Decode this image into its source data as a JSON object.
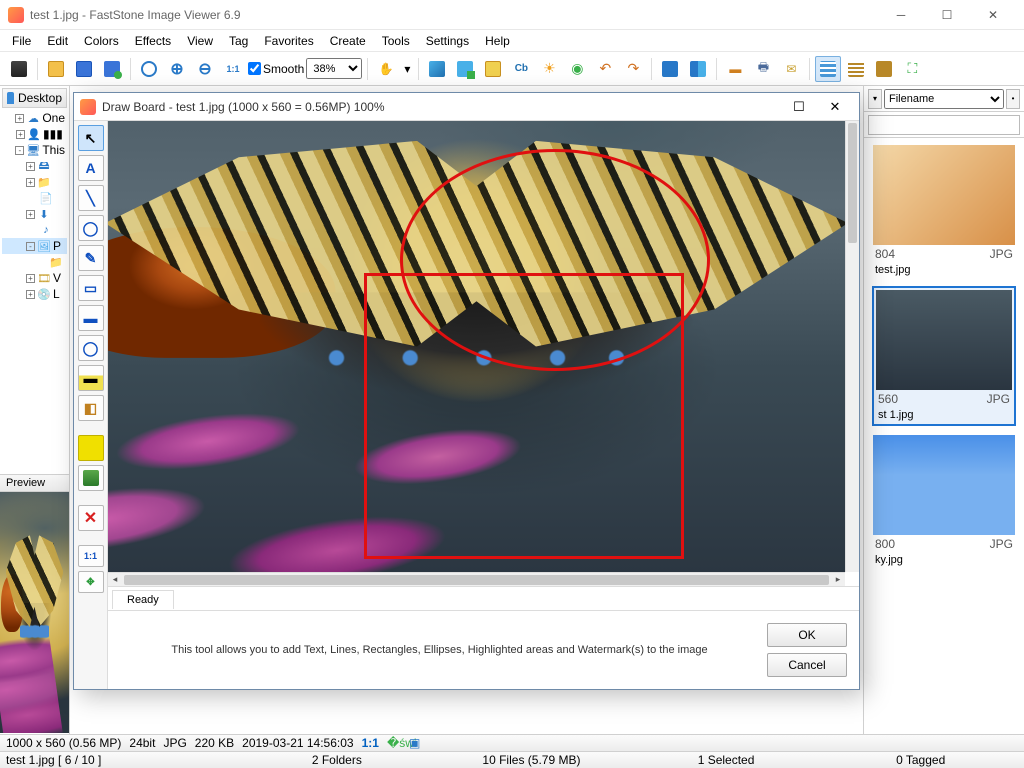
{
  "title": "test 1.jpg  -  FastStone Image Viewer 6.9",
  "menu": [
    "File",
    "Edit",
    "Colors",
    "Effects",
    "View",
    "Tag",
    "Favorites",
    "Create",
    "Tools",
    "Settings",
    "Help"
  ],
  "toolbar": {
    "smooth_label": "Smooth",
    "zoom": "38%"
  },
  "sort_by": "Filename",
  "tree": {
    "root": "Desktop",
    "items": [
      {
        "icon": "cloud",
        "label": "One",
        "indent": 1,
        "exp": "+"
      },
      {
        "icon": "user",
        "label": "▮▮▮",
        "indent": 1,
        "exp": "+"
      },
      {
        "icon": "pc",
        "label": "This",
        "indent": 1,
        "exp": "-",
        "sel": false
      },
      {
        "icon": "drive",
        "label": "",
        "indent": 2,
        "exp": "+"
      },
      {
        "icon": "folder",
        "label": "",
        "indent": 2,
        "exp": "+"
      },
      {
        "icon": "doc",
        "label": "",
        "indent": 2,
        "exp": ""
      },
      {
        "icon": "down",
        "label": "",
        "indent": 2,
        "exp": "+"
      },
      {
        "icon": "music",
        "label": "",
        "indent": 2,
        "exp": ""
      },
      {
        "icon": "pic",
        "label": "P",
        "indent": 2,
        "exp": "-",
        "sel": true
      },
      {
        "icon": "folder",
        "label": "",
        "indent": 3,
        "exp": ""
      },
      {
        "icon": "video",
        "label": "V",
        "indent": 2,
        "exp": "+"
      },
      {
        "icon": "disk",
        "label": "L",
        "indent": 2,
        "exp": "+"
      }
    ]
  },
  "preview_label": "Preview",
  "thumbs": [
    {
      "dim": "804",
      "ext": "JPG",
      "name": "test.jpg",
      "kind": "drinks",
      "sel": false
    },
    {
      "dim": "560",
      "ext": "JPG",
      "name": "st 1.jpg",
      "kind": "butterfly",
      "sel": true
    },
    {
      "dim": "800",
      "ext": "JPG",
      "name": "ky.jpg",
      "kind": "sky",
      "sel": false
    }
  ],
  "status1": {
    "dims": "1000 x 560 (0.56 MP)",
    "depth": "24bit",
    "fmt": "JPG",
    "size": "220 KB",
    "date": "2019-03-21 14:56:03",
    "ratio": "1:1"
  },
  "status2": {
    "file": "test 1.jpg [ 6 / 10 ]",
    "folders": "2 Folders",
    "files": "10 Files (5.79 MB)",
    "selected": "1 Selected",
    "tagged": "0 Tagged"
  },
  "draw": {
    "title": "Draw Board  -  test 1.jpg   (1000 x 560 = 0.56MP)     100%",
    "status": "Ready",
    "hint": "This tool allows you to add Text, Lines, Rectangles, Ellipses, Highlighted areas and Watermark(s) to the image",
    "ok": "OK",
    "cancel": "Cancel"
  }
}
